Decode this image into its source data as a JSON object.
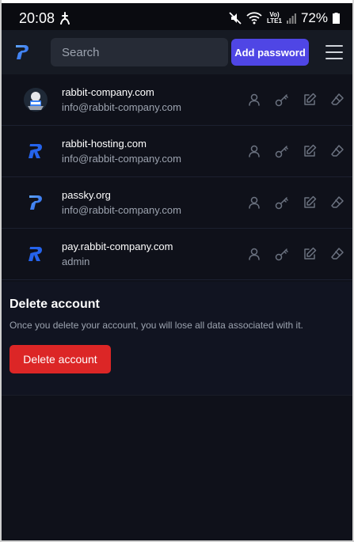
{
  "status_bar": {
    "time": "20:08",
    "volte": "Vo)",
    "lte": "LTE1",
    "battery": "72%"
  },
  "navbar": {
    "search_placeholder": "Search",
    "add_label": "Add password"
  },
  "passwords": [
    {
      "website": "rabbit-company.com",
      "username": "info@rabbit-company.com",
      "icon": "craft-logo"
    },
    {
      "website": "rabbit-hosting.com",
      "username": "info@rabbit-company.com",
      "icon": "rabbit-hosting-logo"
    },
    {
      "website": "passky.org",
      "username": "info@rabbit-company.com",
      "icon": "passky-logo"
    },
    {
      "website": "pay.rabbit-company.com",
      "username": "admin",
      "icon": "rabbit-pay-logo"
    }
  ],
  "delete_section": {
    "title": "Delete account",
    "description": "Once you delete your account, you will lose all data associated with it.",
    "button_label": "Delete account"
  },
  "colors": {
    "accent": "#4f46e5",
    "danger": "#dc2626",
    "background": "#0f111a"
  }
}
